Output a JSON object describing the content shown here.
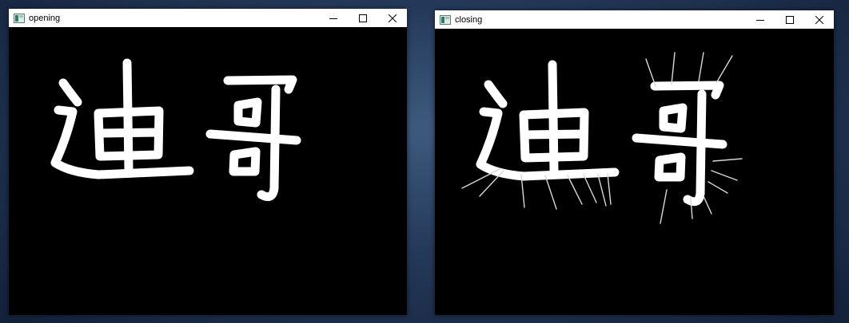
{
  "windows": [
    {
      "title": "opening",
      "image_text": "迪哥",
      "controls": {
        "minimize": "minimize-icon",
        "maximize": "maximize-icon",
        "close": "close-icon"
      }
    },
    {
      "title": "closing",
      "image_text": "迪哥",
      "controls": {
        "minimize": "minimize-icon",
        "maximize": "maximize-icon",
        "close": "close-icon"
      }
    }
  ],
  "colors": {
    "canvas_background": "#000000",
    "stroke": "#ffffff",
    "titlebar": "#ffffff",
    "desktop": "#24395a"
  }
}
